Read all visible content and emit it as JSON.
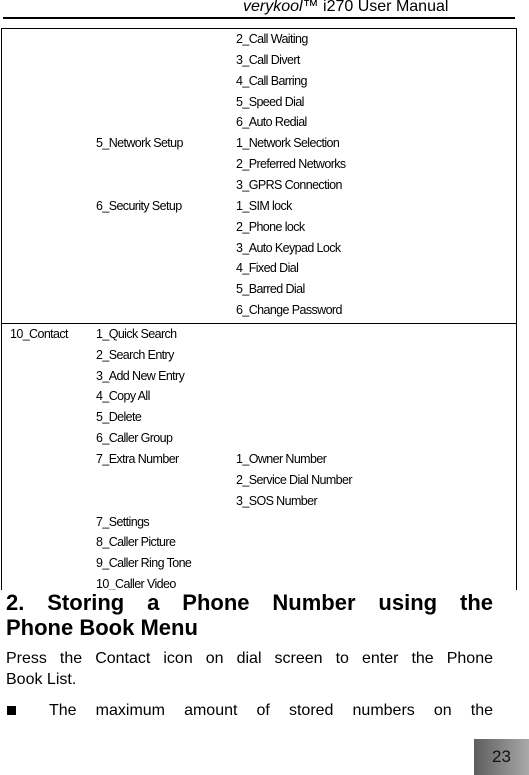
{
  "header": {
    "brand": "verykool",
    "trademark": "™",
    "title_rest": " i270 User Manual"
  },
  "menu_table": {
    "rows": [
      {
        "level1": "",
        "entries": [
          {
            "level2": "",
            "level3": "2_Call Waiting"
          },
          {
            "level2": "",
            "level3": "3_Call Divert"
          },
          {
            "level2": "",
            "level3": "4_Call Barring"
          },
          {
            "level2": "",
            "level3": "5_Speed Dial"
          },
          {
            "level2": "",
            "level3": "6_Auto Redial"
          },
          {
            "level2": "5_Network Setup",
            "level3": "1_Network Selection"
          },
          {
            "level2": "",
            "level3": "2_Preferred Networks"
          },
          {
            "level2": "",
            "level3": "3_GPRS Connection"
          },
          {
            "level2": "6_Security Setup",
            "level3": "1_SIM lock"
          },
          {
            "level2": "",
            "level3": "2_Phone lock"
          },
          {
            "level2": "",
            "level3": "3_Auto Keypad Lock"
          },
          {
            "level2": "",
            "level3": "4_Fixed Dial"
          },
          {
            "level2": "",
            "level3": "5_Barred Dial"
          },
          {
            "level2": "",
            "level3": "6_Change Password"
          }
        ]
      },
      {
        "level1": "10_Contact",
        "entries": [
          {
            "level2": "1_Quick Search",
            "level3": ""
          },
          {
            "level2": "2_Search Entry",
            "level3": ""
          },
          {
            "level2": "3_Add New Entry",
            "level3": ""
          },
          {
            "level2": "4_Copy All",
            "level3": ""
          },
          {
            "level2": "5_Delete",
            "level3": ""
          },
          {
            "level2": "6_Caller Group",
            "level3": ""
          },
          {
            "level2": "7_Extra Number",
            "level3": "1_Owner Number"
          },
          {
            "level2": "",
            "level3": "2_Service Dial Number"
          },
          {
            "level2": "",
            "level3": "3_SOS Number"
          },
          {
            "level2": "7_Settings",
            "level3": ""
          },
          {
            "level2": "8_Caller Picture",
            "level3": ""
          },
          {
            "level2": "9_Caller Ring Tone",
            "level3": ""
          },
          {
            "level2": "10_Caller Video",
            "level3": ""
          }
        ]
      }
    ]
  },
  "section": {
    "heading_line1": "2. Storing a Phone Number using the",
    "heading_line2": "Phone Book Menu",
    "paragraph_line1": "Press the Contact icon on dial screen to enter the Phone",
    "paragraph_line2": "Book List.",
    "bullet_text": "The maximum amount of stored numbers on the"
  },
  "footer": {
    "page_number": "23"
  }
}
